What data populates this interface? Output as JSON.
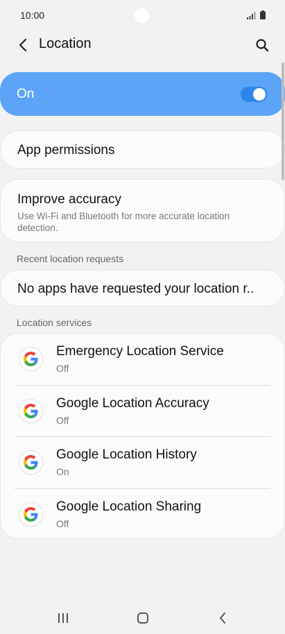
{
  "status_bar": {
    "time": "10:00"
  },
  "header": {
    "title": "Location"
  },
  "master": {
    "label": "On",
    "enabled": true,
    "accent": "#5ba4f7"
  },
  "app_permissions": {
    "label": "App permissions"
  },
  "improve_accuracy": {
    "title": "Improve accuracy",
    "subtitle": "Use Wi-Fi and Bluetooth for more accurate location detection."
  },
  "recent_requests": {
    "heading": "Recent location requests",
    "message": "No apps have requested your location r.."
  },
  "services": {
    "heading": "Location services",
    "items": [
      {
        "title": "Emergency Location Service",
        "status": "Off"
      },
      {
        "title": "Google Location Accuracy",
        "status": "Off"
      },
      {
        "title": "Google Location History",
        "status": "On"
      },
      {
        "title": "Google Location Sharing",
        "status": "Off"
      }
    ]
  },
  "icons": {
    "back": "chevron-left-icon",
    "search": "search-icon",
    "service": "google-logo-icon",
    "nav_recent": "recent-apps-icon",
    "nav_home": "home-icon",
    "nav_back": "back-icon"
  }
}
